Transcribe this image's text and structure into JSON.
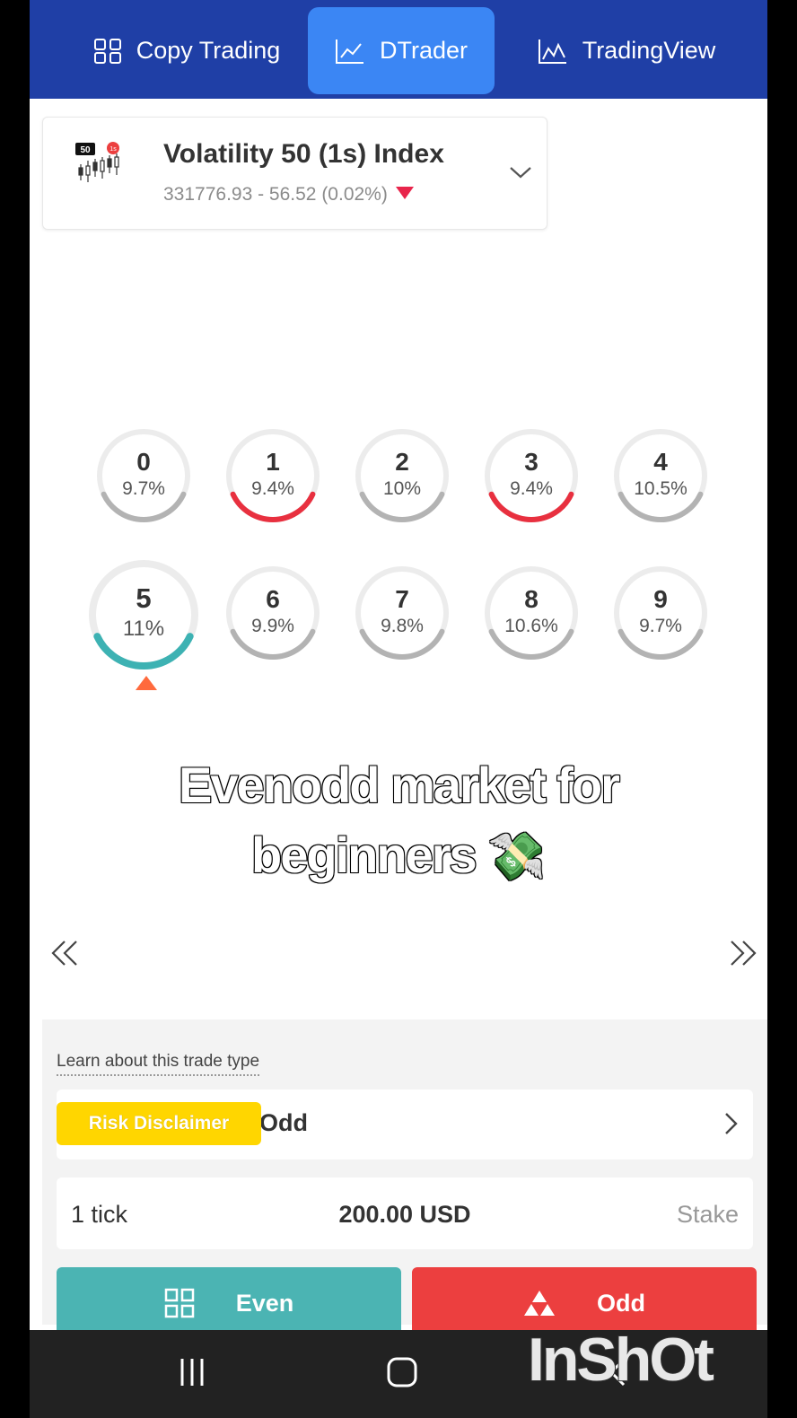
{
  "colors": {
    "nav_bg": "#1f3fa6",
    "nav_active": "#3b86f4",
    "teal": "#4bb4b3",
    "red": "#ec3f3f",
    "yellow": "#ffd600"
  },
  "nav": {
    "tabs": [
      {
        "label": "Copy Trading",
        "icon": "grid-icon"
      },
      {
        "label": "DTrader",
        "icon": "line-chart-icon",
        "active": true
      },
      {
        "label": "TradingView",
        "icon": "chart-icon"
      }
    ]
  },
  "market": {
    "name": "Volatility 50 (1s) Index",
    "logo_badge": "50",
    "logo_tag": "1s",
    "quote": "331776.93 - 56.52 (0.02%)",
    "direction": "down"
  },
  "digits": [
    {
      "digit": "0",
      "percent": "9.7%",
      "state": "neutral"
    },
    {
      "digit": "1",
      "percent": "9.4%",
      "state": "lowest"
    },
    {
      "digit": "2",
      "percent": "10%",
      "state": "neutral"
    },
    {
      "digit": "3",
      "percent": "9.4%",
      "state": "lowest"
    },
    {
      "digit": "4",
      "percent": "10.5%",
      "state": "neutral"
    },
    {
      "digit": "5",
      "percent": "11%",
      "state": "highest",
      "current": true
    },
    {
      "digit": "6",
      "percent": "9.9%",
      "state": "neutral"
    },
    {
      "digit": "7",
      "percent": "9.8%",
      "state": "neutral"
    },
    {
      "digit": "8",
      "percent": "10.6%",
      "state": "neutral"
    },
    {
      "digit": "9",
      "percent": "9.7%",
      "state": "neutral"
    }
  ],
  "caption": {
    "line1": "Evenodd market for",
    "line2": "beginners",
    "emoji": "💸"
  },
  "trade": {
    "learn_link": "Learn about this trade type",
    "trade_type_label": "Odd",
    "risk_disclaimer": "Risk Disclaimer",
    "duration": "1 tick",
    "stake_amount": "200.00 USD",
    "stake_label": "Stake",
    "even_label": "Even",
    "odd_label": "Odd"
  },
  "watermark": "InShOt"
}
